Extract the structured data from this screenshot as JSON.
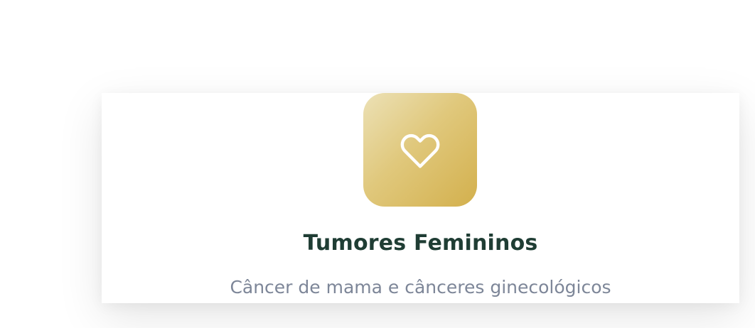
{
  "card": {
    "icon": "heart-icon",
    "title": "Tumores Femininos",
    "description": "Câncer de mama e cânceres ginecológicos"
  },
  "colors": {
    "title": "#1f3d34",
    "description": "#7d8698",
    "icon_gradient_start": "#ece1b6",
    "icon_gradient_end": "#d3b04d",
    "icon_stroke": "#ffffff"
  }
}
